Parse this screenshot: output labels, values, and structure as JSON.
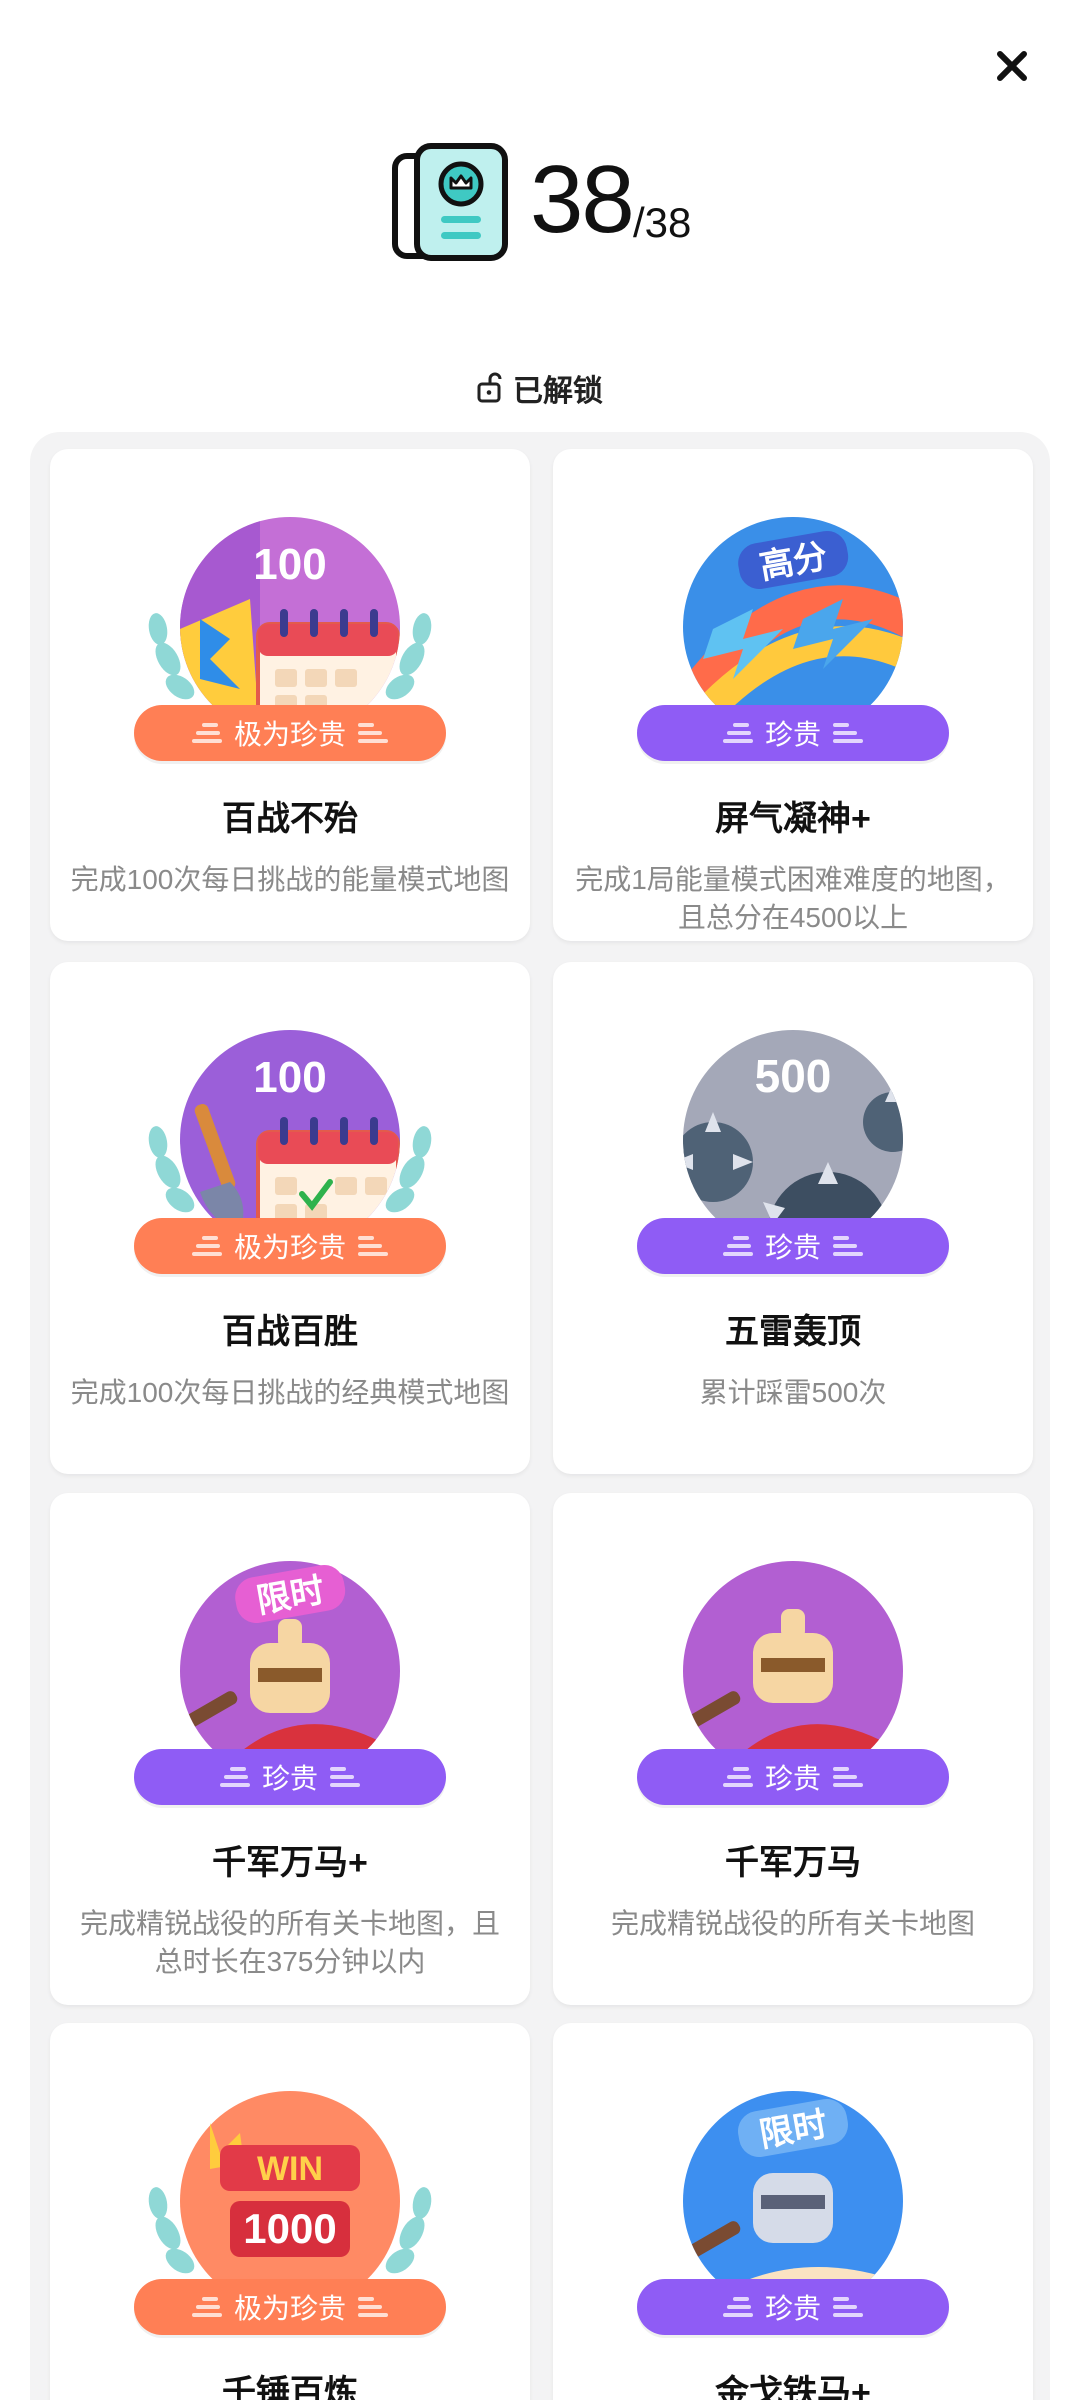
{
  "header": {
    "close_icon": "close-icon",
    "book_icon": "achievement-book-icon",
    "count_unlocked": "38",
    "count_total": "/38"
  },
  "section": {
    "label": "已解锁",
    "icon": "unlock-icon"
  },
  "colors": {
    "rare_orange": "#ff7f55",
    "rare_purple": "#8f5cf5",
    "panel_bg": "#f3f3f4"
  },
  "achievements": [
    {
      "title": "百战不殆",
      "desc": "完成100次每日挑战的能量模式地图",
      "rarity": "极为珍贵",
      "badge_text": "100",
      "badge_icon": "calendar-lightning-badge-icon"
    },
    {
      "title": "屏气凝神+",
      "desc": "完成1局能量模式困难难度的地图，且总分在4500以上",
      "rarity": "珍贵",
      "badge_text": "高分",
      "badge_icon": "rainbow-lightning-badge-icon"
    },
    {
      "title": "百战百胜",
      "desc": "完成100次每日挑战的经典模式地图",
      "rarity": "极为珍贵",
      "badge_text": "100",
      "badge_icon": "calendar-shovel-badge-icon"
    },
    {
      "title": "五雷轰顶",
      "desc": "累计踩雷500次",
      "rarity": "珍贵",
      "badge_text": "500",
      "badge_icon": "spiked-mine-badge-icon"
    },
    {
      "title": "千军万马+",
      "desc": "完成精锐战役的所有关卡地图，且总时长在375分钟以内",
      "rarity": "珍贵",
      "badge_text": "限时",
      "badge_icon": "knight-badge-icon"
    },
    {
      "title": "千军万马",
      "desc": "完成精锐战役的所有关卡地图",
      "rarity": "珍贵",
      "badge_text": "",
      "badge_icon": "knight-badge-icon"
    },
    {
      "title": "千锤百炼",
      "desc": "",
      "rarity": "极为珍贵",
      "badge_text": "1000",
      "badge_label": "WIN",
      "badge_icon": "win-crown-badge-icon"
    },
    {
      "title": "金戈铁马+",
      "desc": "",
      "rarity": "珍贵",
      "badge_text": "限时",
      "badge_icon": "armored-knight-badge-icon"
    }
  ]
}
